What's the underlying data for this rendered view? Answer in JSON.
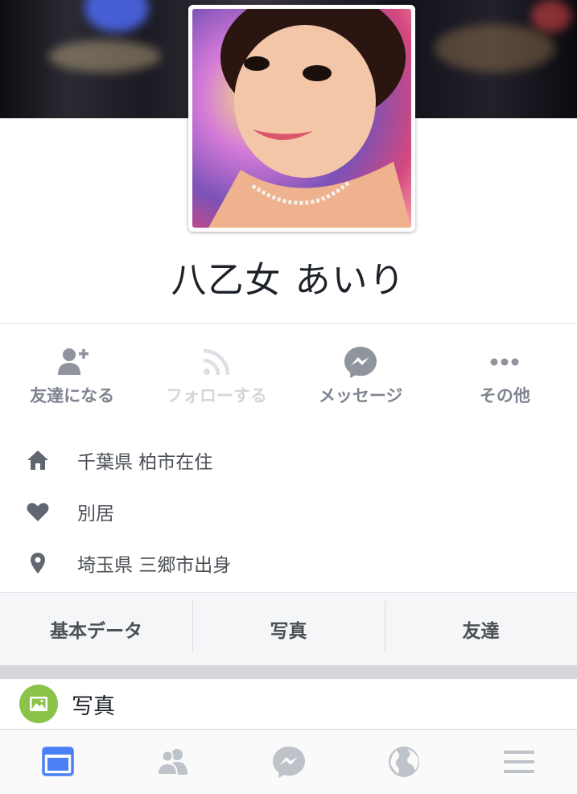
{
  "profile": {
    "name": "八乙女 あいり"
  },
  "actions": [
    {
      "label": "友達になる",
      "icon": "add-friend-icon",
      "enabled": true
    },
    {
      "label": "フォローする",
      "icon": "follow-rss-icon",
      "enabled": false
    },
    {
      "label": "メッセージ",
      "icon": "messenger-icon",
      "enabled": true
    },
    {
      "label": "その他",
      "icon": "more-icon",
      "enabled": true
    }
  ],
  "info": [
    {
      "icon": "home-icon",
      "text": "千葉県 柏市在住"
    },
    {
      "icon": "heart-icon",
      "text": "別居"
    },
    {
      "icon": "location-pin-icon",
      "text": "埼玉県 三郷市出身"
    }
  ],
  "tabs": [
    "基本データ",
    "写真",
    "友達"
  ],
  "photos_section": {
    "title": "写真",
    "icon": "photo-icon"
  },
  "bottom_nav": [
    {
      "icon": "news-feed-icon",
      "active": true
    },
    {
      "icon": "friends-icon",
      "active": false
    },
    {
      "icon": "messenger-icon",
      "active": false
    },
    {
      "icon": "globe-icon",
      "active": false
    },
    {
      "icon": "menu-icon",
      "active": false
    }
  ],
  "colors": {
    "active_blue": "#4a80f5",
    "icon_gray": "#90949c",
    "text_gray": "#4b4f56",
    "photo_green": "#8bc34a"
  }
}
